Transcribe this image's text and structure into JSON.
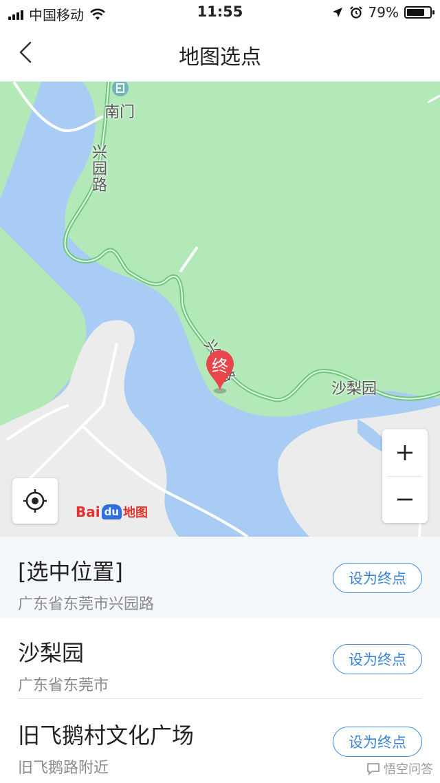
{
  "status_bar": {
    "carrier": "中国移动",
    "time": "11:55",
    "battery": "79%",
    "battery_level": 0.79
  },
  "nav": {
    "title": "地图选点"
  },
  "map": {
    "labels": {
      "south_gate": "南门",
      "road_vertical_1": "兴园路",
      "road_vertical_2": "兴园路",
      "shali_garden": "沙梨园"
    },
    "marker_text": "终",
    "logo": "Bai du 地图",
    "colors": {
      "water": "#a9ccf4",
      "land": "#b3e8b8",
      "urban": "#ececec",
      "road": "#6cc87c",
      "marker": "#e8464a"
    }
  },
  "results": [
    {
      "name": "[选中位置]",
      "address": "广东省东莞市兴园路",
      "action": "设为终点",
      "selected": true
    },
    {
      "name": "沙梨园",
      "address": "广东省东莞市",
      "action": "设为终点",
      "selected": false
    },
    {
      "name": "旧飞鹅村文化广场",
      "address": "旧飞鹅路附近",
      "action": "设为终点",
      "selected": false
    }
  ],
  "watermark": "悟空问答"
}
